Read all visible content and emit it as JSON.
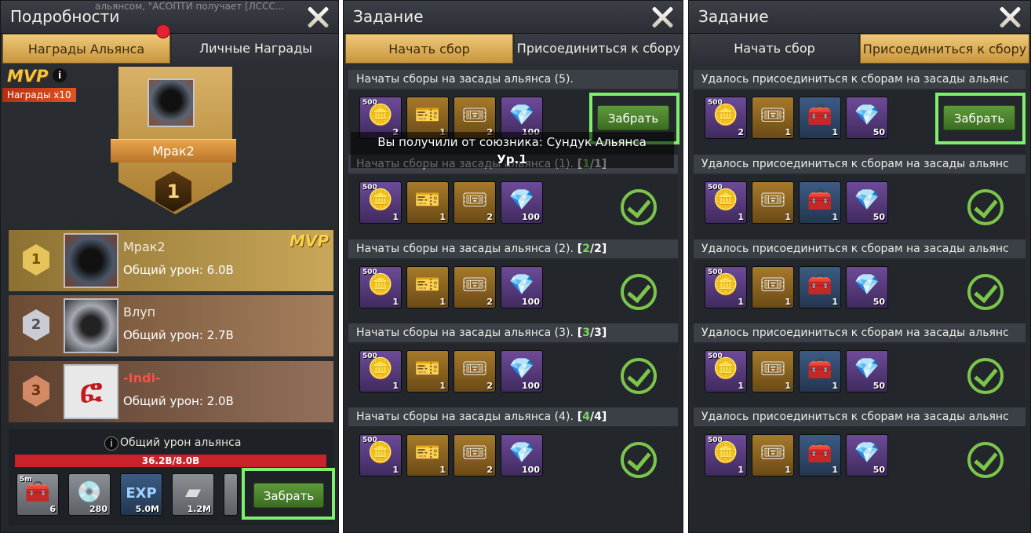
{
  "left": {
    "title": "Подробности",
    "ticker": "альянсом, \"АСОПТИ получает [ЛССС...",
    "tabs": [
      "Награды Альянса",
      "Личные Награды"
    ],
    "mvp": "MVP",
    "info": "i",
    "rewards_multiplier": "Награды x10",
    "mvp_player": "Мрак2",
    "mvp_rank": "1",
    "ranking": [
      {
        "rank": "1",
        "name": "Мрак2",
        "damage": "Общий урон: 6.0B",
        "badge": "MVP"
      },
      {
        "rank": "2",
        "name": "Влуп",
        "damage": "Общий урон: 2.7B"
      },
      {
        "rank": "3",
        "name": "-Indi-",
        "damage": "Общий урон: 2.0B",
        "avatar_glyph": "ፎ"
      }
    ],
    "alliance_damage_label": "Общий урон альянса",
    "progress_text": "36.2B/8.0B",
    "progress_fraction": 1.0,
    "rewards": [
      {
        "top": "5m",
        "qty": "6",
        "icon": "chest-icon"
      },
      {
        "qty": "280",
        "icon": "disc-icon"
      },
      {
        "qty": "5.0M",
        "icon": "exp-icon"
      },
      {
        "qty": "1.2M",
        "icon": "steel-icon"
      }
    ],
    "claim": "Забрать"
  },
  "middle": {
    "title": "Задание",
    "tabs": [
      "Начать сбор",
      "Присоединиться к сбору"
    ],
    "tooltip_line1": "Вы получили от союзника: Сундук Альянса",
    "tooltip_line2": "Ур.1",
    "tasks": [
      {
        "title": "Начаты сборы на засады альянса (5).",
        "count_done": "",
        "count_total": "",
        "items": [
          "2",
          "1",
          "2",
          "100"
        ],
        "claim": "Забрать"
      },
      {
        "title": "Начаты сборы на засады альянса (1).",
        "count_done": "1",
        "count_total": "1",
        "items": [
          "1",
          "1",
          "2",
          "100"
        ]
      },
      {
        "title": "Начаты сборы на засады альянса (2).",
        "count_done": "2",
        "count_total": "2",
        "items": [
          "1",
          "1",
          "2",
          "100"
        ]
      },
      {
        "title": "Начаты сборы на засады альянса (3).",
        "count_done": "3",
        "count_total": "3",
        "items": [
          "1",
          "1",
          "2",
          "100"
        ]
      },
      {
        "title": "Начаты сборы на засады альянса (4).",
        "count_done": "4",
        "count_total": "4",
        "items": [
          "1",
          "1",
          "2",
          "100"
        ]
      }
    ]
  },
  "right": {
    "title": "Задание",
    "tabs": [
      "Начать сбор",
      "Присоединиться к сбору"
    ],
    "tasks": [
      {
        "title": "Удалось присоединиться к сборам на засады альянс",
        "items": [
          "2",
          "1",
          "1",
          "50"
        ],
        "claim": "Забрать"
      },
      {
        "title": "Удалось присоединиться к сборам на засады альянс",
        "items": [
          "1",
          "1",
          "1",
          "50"
        ]
      },
      {
        "title": "Удалось присоединиться к сборам на засады альянс",
        "items": [
          "1",
          "1",
          "1",
          "50"
        ]
      },
      {
        "title": "Удалось присоединиться к сборам на засады альянс",
        "items": [
          "1",
          "1",
          "1",
          "50"
        ]
      },
      {
        "title": "Удалось присоединиться к сборам на засады альянс",
        "items": [
          "1",
          "1",
          "1",
          "50"
        ]
      }
    ]
  },
  "item_label_500": "500",
  "colors": {
    "accent_green": "#7ff06d",
    "tab_gold": "#e2b864",
    "progress_red": "#c9222a"
  }
}
